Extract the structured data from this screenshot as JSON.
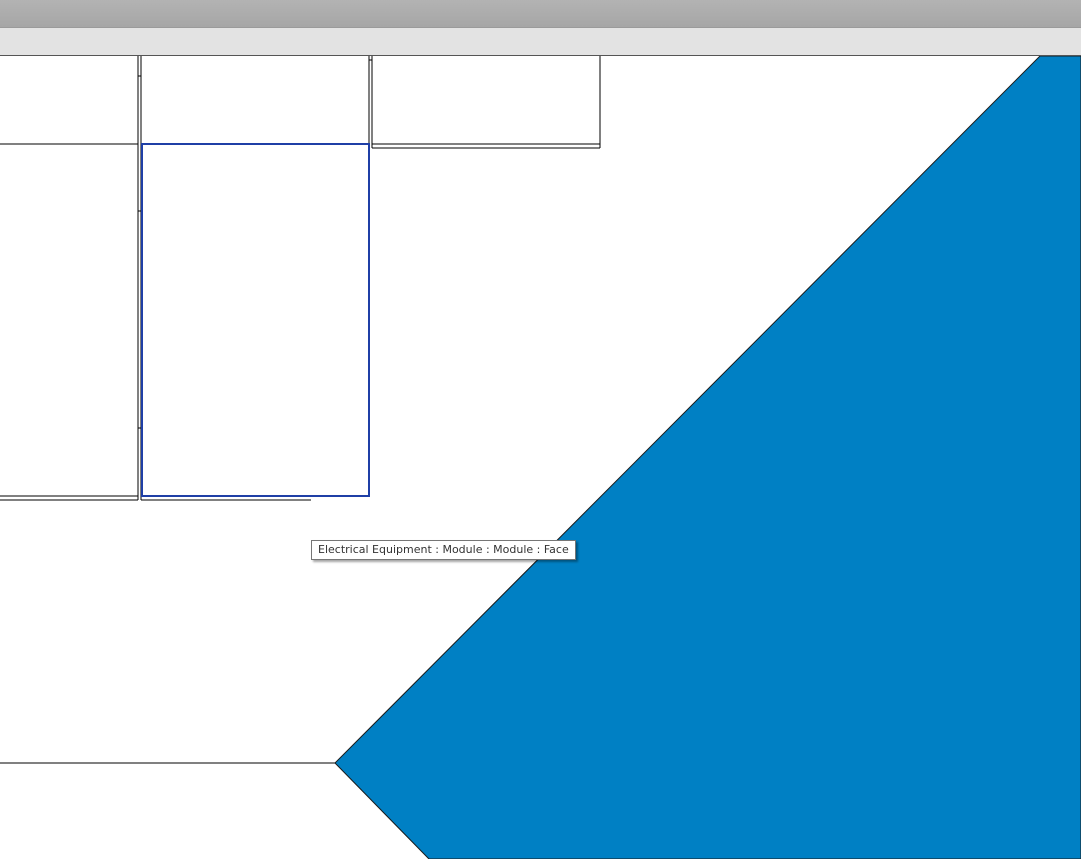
{
  "window": {
    "title": ""
  },
  "tabstrip": {
    "tabs": []
  },
  "canvas": {
    "background_color": "#ffffff",
    "floor_color": "#0080c4",
    "highlight_color": "#1f3fa6",
    "line_color": "#000000"
  },
  "tooltip": {
    "text": "Electrical Equipment : Module : Module : Face"
  }
}
